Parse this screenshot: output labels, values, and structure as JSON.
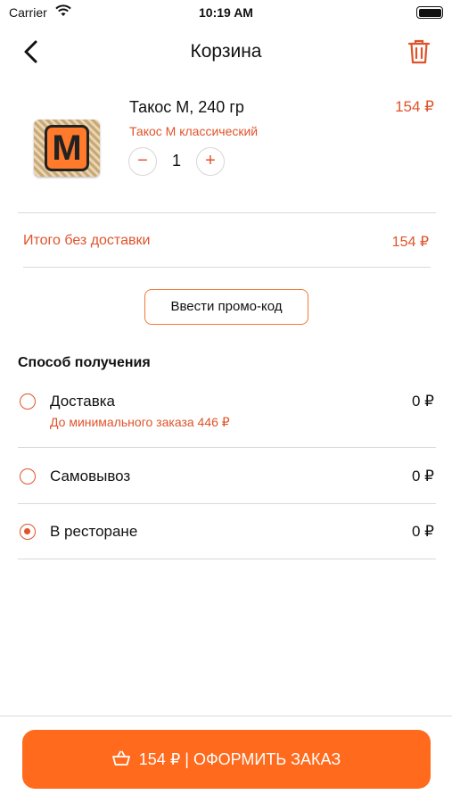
{
  "status_bar": {
    "carrier": "Carrier",
    "time": "10:19 AM"
  },
  "nav": {
    "title": "Корзина",
    "back_icon": "chevron-left-icon",
    "trash_icon": "trash-icon"
  },
  "product": {
    "name": "Такос М, 240 гр",
    "price": "154 ₽",
    "variant": "Такос М классический",
    "quantity": "1",
    "minus_label": "−",
    "plus_label": "+",
    "thumb_letter": "M"
  },
  "subtotal": {
    "label": "Итого без доставки",
    "value": "154 ₽"
  },
  "promo": {
    "label": "Ввести промо-код"
  },
  "delivery": {
    "title": "Способ получения",
    "options": [
      {
        "label": "Доставка",
        "price": "0 ₽",
        "note": "До минимального заказа 446 ₽",
        "selected": false
      },
      {
        "label": "Самовывоз",
        "price": "0 ₽",
        "selected": false
      },
      {
        "label": "В ресторане",
        "price": "0 ₽",
        "selected": true
      }
    ]
  },
  "checkout": {
    "label": "154 ₽ | ОФОРМИТЬ ЗАКАЗ",
    "icon": "basket-icon"
  },
  "colors": {
    "accent": "#e0532a",
    "button": "#ff6a1c"
  }
}
